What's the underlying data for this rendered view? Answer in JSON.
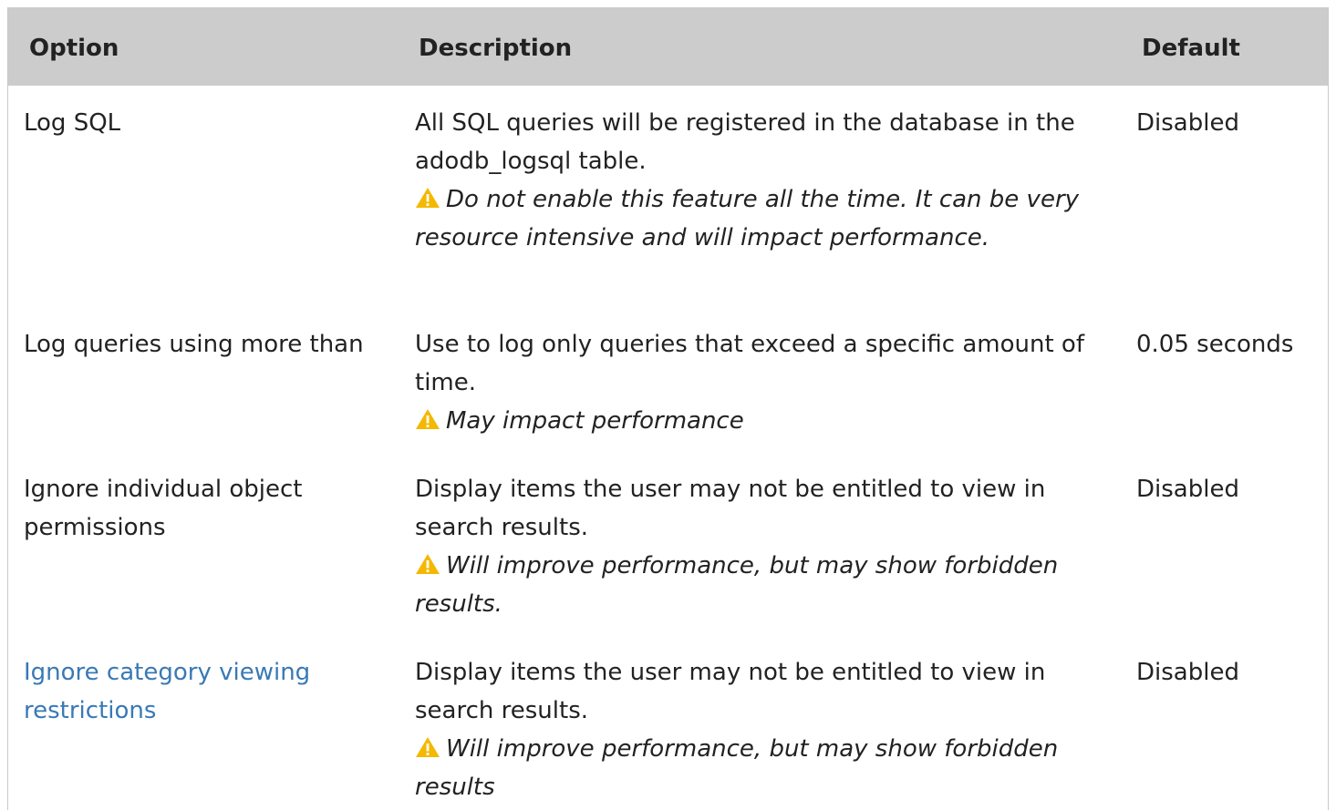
{
  "table": {
    "headers": {
      "option": "Option",
      "description": "Description",
      "default": "Default"
    },
    "rows": [
      {
        "option": "Log SQL",
        "option_is_link": false,
        "description": "All SQL queries will be registered in the database in the adodb_logsql table.",
        "warning": "Do not enable this feature all the time. It can be very resource intensive and will impact performance.",
        "default": "Disabled"
      },
      {
        "option": "Log queries using more than",
        "option_is_link": false,
        "description": "Use to log only queries that exceed a specific amount of time.",
        "warning": "May impact performance",
        "default": "0.05 seconds"
      },
      {
        "option": "Ignore individual object permissions",
        "option_is_link": false,
        "description": "Display items the user may not be entitled to view in search results.",
        "warning": "Will improve performance, but may show forbidden results.",
        "default": "Disabled"
      },
      {
        "option": "Ignore category viewing restrictions",
        "option_is_link": true,
        "description": "Display items the user may not be entitled to view in search results.",
        "warning": "Will improve performance, but may show forbidden results",
        "default": "Disabled"
      }
    ]
  },
  "colors": {
    "header_bg": "#cccccc",
    "link": "#3979b5",
    "warning_icon": "#f5b800",
    "text": "#222222"
  },
  "icons": {
    "warning": "warning-triangle-icon"
  }
}
